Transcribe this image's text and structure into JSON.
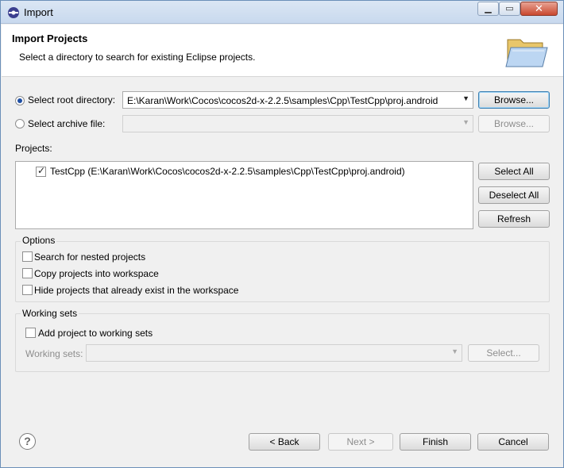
{
  "window": {
    "title": "Import"
  },
  "header": {
    "title": "Import Projects",
    "description": "Select a directory to search for existing Eclipse projects."
  },
  "source": {
    "root_label": "Select root directory:",
    "root_value": "E:\\Karan\\Work\\Cocos\\cocos2d-x-2.2.5\\samples\\Cpp\\TestCpp\\proj.android",
    "root_browse": "Browse...",
    "archive_label": "Select archive file:",
    "archive_value": "",
    "archive_browse": "Browse..."
  },
  "projects": {
    "label": "Projects:",
    "items": [
      {
        "label": "TestCpp (E:\\Karan\\Work\\Cocos\\cocos2d-x-2.2.5\\samples\\Cpp\\TestCpp\\proj.android)",
        "checked": true
      }
    ],
    "select_all": "Select All",
    "deselect_all": "Deselect All",
    "refresh": "Refresh"
  },
  "options": {
    "title": "Options",
    "search_nested": "Search for nested projects",
    "copy_projects": "Copy projects into workspace",
    "hide_existing": "Hide projects that already exist in the workspace"
  },
  "working_sets": {
    "title": "Working sets",
    "add_label": "Add project to working sets",
    "sets_label": "Working sets:",
    "sets_value": "",
    "select_button": "Select..."
  },
  "footer": {
    "help": "?",
    "back": "< Back",
    "next": "Next >",
    "finish": "Finish",
    "cancel": "Cancel"
  }
}
